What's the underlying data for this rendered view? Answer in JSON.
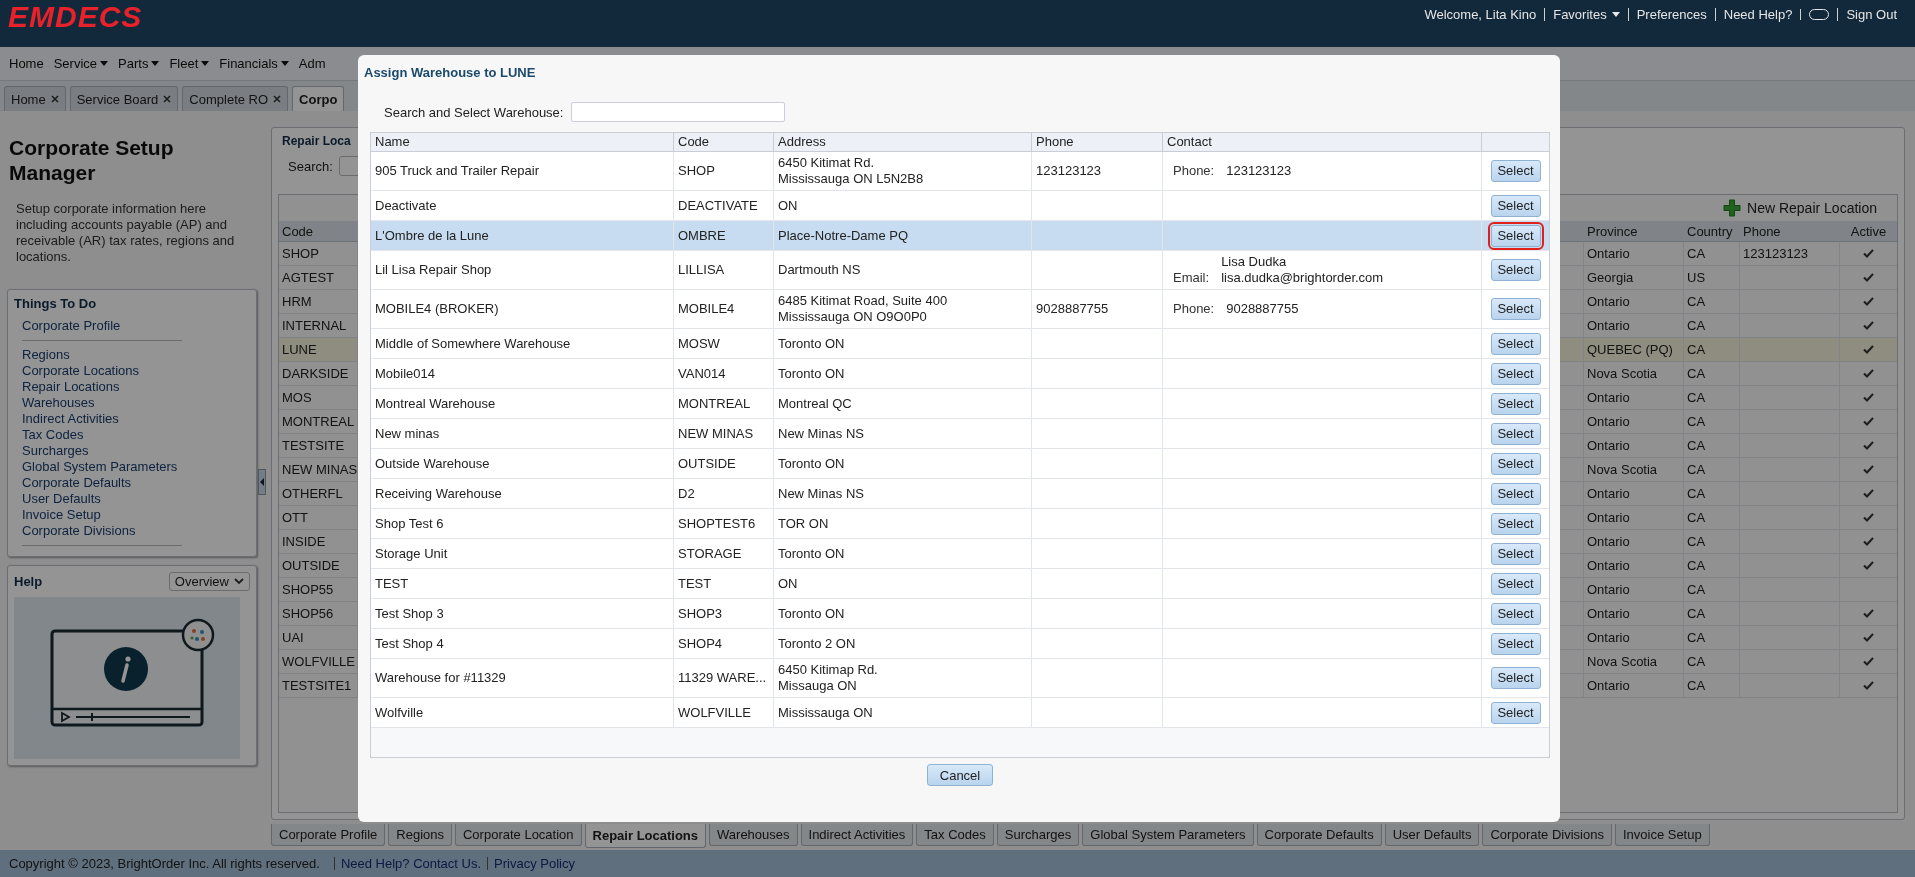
{
  "header": {
    "logo": "EMDECS",
    "items": [
      {
        "kind": "text",
        "label": "Welcome, Lita Kino"
      },
      {
        "kind": "menu",
        "label": "Favorites"
      },
      {
        "kind": "link",
        "label": "Preferences"
      },
      {
        "kind": "link",
        "label": "Need Help?"
      },
      {
        "kind": "icon"
      },
      {
        "kind": "link",
        "label": "Sign Out"
      }
    ]
  },
  "nav_menu": [
    {
      "label": "Home",
      "dropdown": false
    },
    {
      "label": "Service",
      "dropdown": true
    },
    {
      "label": "Parts",
      "dropdown": true
    },
    {
      "label": "Fleet",
      "dropdown": true
    },
    {
      "label": "Financials",
      "dropdown": true
    },
    {
      "label": "Adm",
      "dropdown": false
    }
  ],
  "open_tabs": [
    {
      "label": "Home",
      "selected": false,
      "closable": true
    },
    {
      "label": "Service Board",
      "selected": false,
      "closable": true
    },
    {
      "label": "Complete RO",
      "selected": false,
      "closable": true
    },
    {
      "label": "Corpo",
      "selected": true,
      "closable": false
    }
  ],
  "sidebar": {
    "title": "Corporate Setup Manager",
    "description": "Setup corporate information here including accounts payable (AP) and receivable (AR) tax rates, regions and locations.",
    "things_to_do": {
      "title": "Things To Do",
      "groups": [
        {
          "items": [
            "Corporate Profile"
          ]
        },
        {
          "items": [
            "Regions",
            "Corporate Locations",
            "Repair Locations",
            "Warehouses",
            "Indirect Activities",
            "Tax Codes",
            "Surcharges",
            "Global System Parameters",
            "Corporate Defaults",
            "User Defaults",
            "Invoice Setup",
            "Corporate Divisions"
          ]
        }
      ]
    },
    "help": {
      "title": "Help",
      "dropdown": "Overview"
    }
  },
  "main": {
    "panel_title": "Repair Loca",
    "search_label": "Search:",
    "new_button": "New Repair Location",
    "table": {
      "columns": [
        "Code",
        "Province",
        "Country",
        "Phone",
        "Active"
      ],
      "rows": [
        {
          "code": "SHOP",
          "province": "Ontario",
          "country": "CA",
          "phone": "123123123",
          "active": true,
          "selected": false
        },
        {
          "code": "AGTEST",
          "province": "Georgia",
          "country": "US",
          "active": true,
          "selected": false
        },
        {
          "code": "HRM",
          "province": "Ontario",
          "country": "CA",
          "active": true,
          "selected": false
        },
        {
          "code": "INTERNAL",
          "province": "Ontario",
          "country": "CA",
          "active": true,
          "selected": false
        },
        {
          "code": "LUNE",
          "province": "QUEBEC (PQ)",
          "country": "CA",
          "active": true,
          "selected": true
        },
        {
          "code": "DARKSIDE",
          "province": "Nova Scotia",
          "country": "CA",
          "active": true,
          "selected": false
        },
        {
          "code": "MOS",
          "province": "Ontario",
          "country": "CA",
          "active": true,
          "selected": false
        },
        {
          "code": "MONTREAL",
          "province": "Ontario",
          "country": "CA",
          "active": true,
          "selected": false
        },
        {
          "code": "TESTSITE",
          "province": "Ontario",
          "country": "CA",
          "active": true,
          "selected": false
        },
        {
          "code": "NEW MINAS",
          "province": "Nova Scotia",
          "country": "CA",
          "active": true,
          "selected": false
        },
        {
          "code": "OTHERFL",
          "province": "Ontario",
          "country": "CA",
          "active": true,
          "selected": false
        },
        {
          "code": "OTT",
          "province": "Ontario",
          "country": "CA",
          "active": true,
          "selected": false
        },
        {
          "code": "INSIDE",
          "province": "Ontario",
          "country": "CA",
          "active": true,
          "selected": false
        },
        {
          "code": "OUTSIDE",
          "province": "Ontario",
          "country": "CA",
          "active": true,
          "selected": false
        },
        {
          "code": "SHOP55",
          "province": "Ontario",
          "country": "CA",
          "active": false,
          "selected": false
        },
        {
          "code": "SHOP56",
          "province": "Ontario",
          "country": "CA",
          "active": true,
          "selected": false
        },
        {
          "code": "UAI",
          "province": "Ontario",
          "country": "CA",
          "active": true,
          "selected": false
        },
        {
          "code": "WOLFVILLE",
          "province": "Nova Scotia",
          "country": "CA",
          "active": true,
          "selected": false
        },
        {
          "code": "TESTSITE1",
          "province": "Ontario",
          "country": "CA",
          "active": true,
          "selected": false
        }
      ]
    }
  },
  "bottom_tabs": [
    {
      "label": "Corporate Profile",
      "selected": false
    },
    {
      "label": "Regions",
      "selected": false
    },
    {
      "label": "Corporate Location",
      "selected": false
    },
    {
      "label": "Repair Locations",
      "selected": true
    },
    {
      "label": "Warehouses",
      "selected": false
    },
    {
      "label": "Indirect Activities",
      "selected": false
    },
    {
      "label": "Tax Codes",
      "selected": false
    },
    {
      "label": "Surcharges",
      "selected": false
    },
    {
      "label": "Global System Parameters",
      "selected": false
    },
    {
      "label": "Corporate Defaults",
      "selected": false
    },
    {
      "label": "User Defaults",
      "selected": false
    },
    {
      "label": "Corporate Divisions",
      "selected": false
    },
    {
      "label": "Invoice Setup",
      "selected": false
    }
  ],
  "footer": {
    "copyright": "Copyright © 2023, BrightOrder Inc. All rights reserved.",
    "links": [
      "Need Help? Contact Us.",
      "Privacy Policy"
    ]
  },
  "modal": {
    "title": "Assign Warehouse to LUNE",
    "search_label": "Search and Select Warehouse:",
    "columns": [
      "Name",
      "Code",
      "Address",
      "Phone",
      "Contact"
    ],
    "cancel": "Cancel",
    "rows": [
      {
        "name": "905 Truck and Trailer Repair",
        "code": "SHOP",
        "address": [
          "6450 Kitimat Rd.",
          "Mississauga ON L5N2B8"
        ],
        "phone": "123123123",
        "contact": {
          "label": "Phone:",
          "lines": [
            "123123123"
          ]
        },
        "button": "Select",
        "selected": false
      },
      {
        "name": "Deactivate",
        "code": "DEACTIVATE",
        "address": [
          "ON"
        ],
        "button": "Select",
        "selected": false
      },
      {
        "name": "L'Ombre de la Lune",
        "code": "OMBRE",
        "address": [
          "Place-Notre-Dame PQ"
        ],
        "button": "Select",
        "selected": true
      },
      {
        "name": "Lil Lisa Repair Shop",
        "code": "LILLISA",
        "address": [
          "Dartmouth NS"
        ],
        "contact": {
          "label": "Email:",
          "lines": [
            "Lisa Dudka",
            "lisa.dudka@brightorder.com"
          ]
        },
        "button": "Select",
        "selected": false
      },
      {
        "name": "MOBILE4 (BROKER)",
        "code": "MOBILE4",
        "address": [
          "6485 Kitimat Road, Suite 400",
          "Mississauga ON O9O0P0"
        ],
        "phone": "9028887755",
        "contact": {
          "label": "Phone:",
          "lines": [
            "9028887755"
          ]
        },
        "button": "Select",
        "selected": false
      },
      {
        "name": "Middle of Somewhere Warehouse",
        "code": "MOSW",
        "address": [
          "Toronto ON"
        ],
        "button": "Select",
        "selected": false
      },
      {
        "name": "Mobile014",
        "code": "VAN014",
        "address": [
          "Toronto ON"
        ],
        "button": "Select",
        "selected": false
      },
      {
        "name": "Montreal Warehouse",
        "code": "MONTREAL",
        "address": [
          "Montreal QC"
        ],
        "button": "Select",
        "selected": false
      },
      {
        "name": "New minas",
        "code": "NEW MINAS",
        "address": [
          "New Minas NS"
        ],
        "button": "Select",
        "selected": false
      },
      {
        "name": "Outside Warehouse",
        "code": "OUTSIDE",
        "address": [
          "Toronto ON"
        ],
        "button": "Select",
        "selected": false
      },
      {
        "name": "Receiving Warehouse",
        "code": "D2",
        "address": [
          "New Minas NS"
        ],
        "button": "Select",
        "selected": false
      },
      {
        "name": "Shop Test 6",
        "code": "SHOPTEST6",
        "address": [
          "TOR ON"
        ],
        "button": "Select",
        "selected": false
      },
      {
        "name": "Storage Unit",
        "code": "STORAGE",
        "address": [
          "Toronto ON"
        ],
        "button": "Select",
        "selected": false
      },
      {
        "name": "TEST",
        "code": "TEST",
        "address": [
          "ON"
        ],
        "button": "Select",
        "selected": false
      },
      {
        "name": "Test Shop 3",
        "code": "SHOP3",
        "address": [
          "Toronto ON"
        ],
        "button": "Select",
        "selected": false
      },
      {
        "name": "Test Shop 4",
        "code": "SHOP4",
        "address": [
          "Toronto 2 ON"
        ],
        "button": "Select",
        "selected": false
      },
      {
        "name": "Warehouse for #11329",
        "code": "11329 WARE...",
        "address": [
          "6450 Kitimap Rd.",
          "Missauga ON"
        ],
        "button": "Select",
        "selected": false
      },
      {
        "name": "Wolfville",
        "code": "WOLFVILLE",
        "address": [
          "Mississauga ON"
        ],
        "button": "Select",
        "selected": false
      }
    ]
  }
}
